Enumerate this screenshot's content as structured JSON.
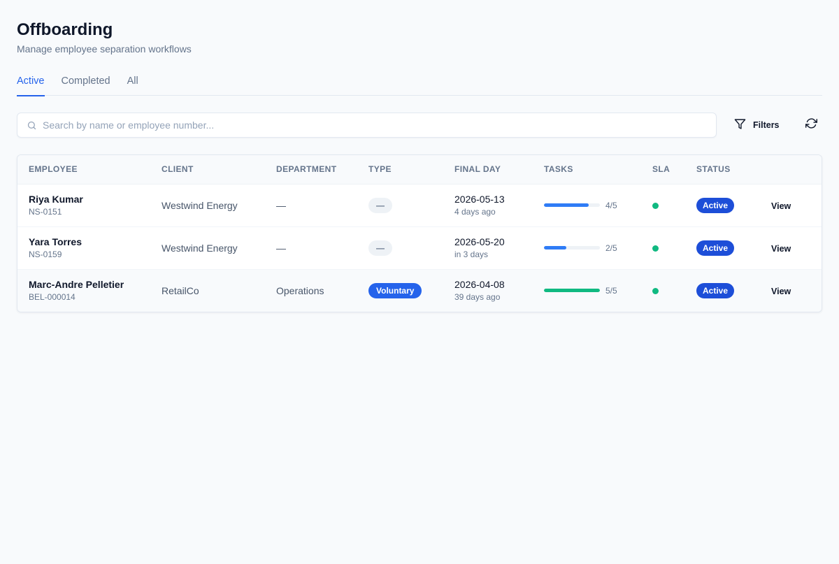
{
  "header": {
    "title": "Offboarding",
    "subtitle": "Manage employee separation workflows"
  },
  "tabs": [
    {
      "label": "Active",
      "active": true
    },
    {
      "label": "Completed",
      "active": false
    },
    {
      "label": "All",
      "active": false
    }
  ],
  "toolbar": {
    "search_placeholder": "Search by name or employee number...",
    "search_value": "",
    "filters_label": "Filters"
  },
  "table": {
    "headers": {
      "employee": "EMPLOYEE",
      "client": "CLIENT",
      "department": "DEPARTMENT",
      "type": "TYPE",
      "final_day": "FINAL DAY",
      "tasks": "TASKS",
      "sla": "SLA",
      "status": "STATUS"
    },
    "rows": [
      {
        "name": "Riya Kumar",
        "number": "NS-0151",
        "client": "Westwind Energy",
        "department": "—",
        "type": "—",
        "type_style": "neutral",
        "final_day": "2026-05-13",
        "final_day_relative": "4 days ago",
        "tasks_done": 4,
        "tasks_total": 5,
        "tasks_label": "4/5",
        "tasks_color": "#2f7cf6",
        "sla_color": "#10b981",
        "status": "Active",
        "action": "View"
      },
      {
        "name": "Yara Torres",
        "number": "NS-0159",
        "client": "Westwind Energy",
        "department": "—",
        "type": "—",
        "type_style": "neutral",
        "final_day": "2026-05-20",
        "final_day_relative": "in 3 days",
        "tasks_done": 2,
        "tasks_total": 5,
        "tasks_label": "2/5",
        "tasks_color": "#2f7cf6",
        "sla_color": "#10b981",
        "status": "Active",
        "action": "View"
      },
      {
        "name": "Marc-Andre Pelletier",
        "number": "BEL-000014",
        "client": "RetailCo",
        "department": "Operations",
        "type": "Voluntary",
        "type_style": "voluntary",
        "final_day": "2026-04-08",
        "final_day_relative": "39 days ago",
        "tasks_done": 5,
        "tasks_total": 5,
        "tasks_label": "5/5",
        "tasks_color": "#10b981",
        "sla_color": "#10b981",
        "status": "Active",
        "action": "View"
      }
    ]
  },
  "colors": {
    "accent": "#2563eb",
    "status_active": "#1d4ed8",
    "success": "#10b981"
  },
  "icons": {
    "search": "search-icon",
    "filter": "filter-icon",
    "refresh": "refresh-icon"
  }
}
